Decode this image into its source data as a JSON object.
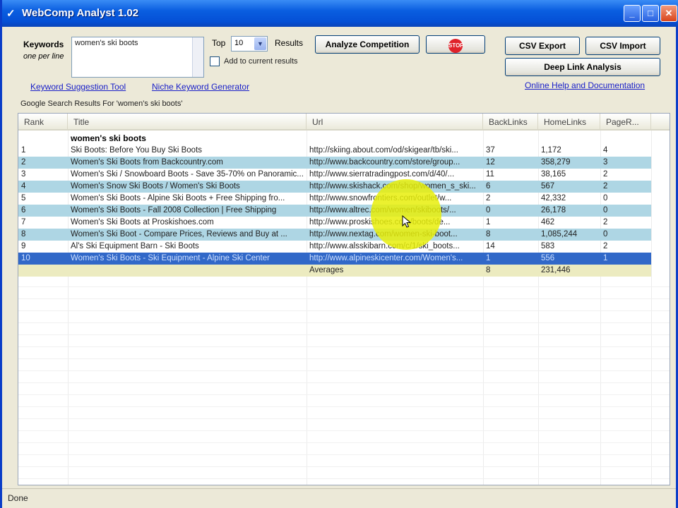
{
  "window": {
    "title": "WebComp Analyst 1.02",
    "minimize": "_",
    "maximize": "□",
    "close": "✕"
  },
  "toolbar": {
    "keywords_label": "Keywords",
    "keywords_sub": "one per line",
    "keywords_value": "women's ski boots",
    "top_label": "Top",
    "top_value": "10",
    "results_label": "Results",
    "add_to_current_label": "Add to current results",
    "add_to_current_checked": false,
    "analyze_button": "Analyze Competition",
    "stop_button": "STOP",
    "csv_export": "CSV Export",
    "csv_import": "CSV Import",
    "deep_link": "Deep Link Analysis",
    "keyword_suggestion_link": "Keyword Suggestion Tool",
    "niche_keyword_link": "Niche Keyword Generator",
    "help_link": "Online Help and Documentation"
  },
  "results_caption": "Google Search Results For 'women's ski boots'",
  "grid": {
    "columns": [
      "Rank",
      "Title",
      "Url",
      "BackLinks",
      "HomeLinks",
      "PageR..."
    ],
    "group_label": "women's ski boots",
    "rows": [
      {
        "rank": "1",
        "title": "Ski Boots: Before You Buy Ski Boots",
        "url": "http://skiing.about.com/od/skigear/tb/ski...",
        "backlinks": "37",
        "homelinks": "1,172",
        "pagerank": "4"
      },
      {
        "rank": "2",
        "title": "Women's Ski Boots from Backcountry.com",
        "url": "http://www.backcountry.com/store/group...",
        "backlinks": "12",
        "homelinks": "358,279",
        "pagerank": "3"
      },
      {
        "rank": "3",
        "title": "Women's Ski / Snowboard Boots - Save 35-70% on Panoramic...",
        "url": "http://www.sierratradingpost.com/d/40/...",
        "backlinks": "11",
        "homelinks": "38,165",
        "pagerank": "2"
      },
      {
        "rank": "4",
        "title": "Women's Snow Ski Boots / Women's Ski Boots",
        "url": "http://www.skishack.com/shop/women_s_ski...",
        "backlinks": "6",
        "homelinks": "567",
        "pagerank": "2"
      },
      {
        "rank": "5",
        "title": "Women's Ski Boots - Alpine Ski Boots + Free Shipping fro...",
        "url": "http://www.snowfrontiers.com/outlet/w...",
        "backlinks": "2",
        "homelinks": "42,332",
        "pagerank": "0"
      },
      {
        "rank": "6",
        "title": "Women's Ski Boots - Fall 2008 Collection | Free Shipping",
        "url": "http://www.altrec.com/women/skiboots/...",
        "backlinks": "0",
        "homelinks": "26,178",
        "pagerank": "0"
      },
      {
        "rank": "7",
        "title": "Women's Ski Boots at Proskishoes.com",
        "url": "http://www.proskishoes.com/boots/de...",
        "backlinks": "1",
        "homelinks": "462",
        "pagerank": "2"
      },
      {
        "rank": "8",
        "title": "Women's Ski Boot - Compare Prices, Reviews and Buy at ...",
        "url": "http://www.nextag.com/women-ski-boot...",
        "backlinks": "8",
        "homelinks": "1,085,244",
        "pagerank": "0"
      },
      {
        "rank": "9",
        "title": "Al's Ski Equipment Barn - Ski Boots",
        "url": "http://www.alsskibarn.com/c/1/ski_boots...",
        "backlinks": "14",
        "homelinks": "583",
        "pagerank": "2"
      },
      {
        "rank": "10",
        "title": "Women's Ski Boots - Ski Equipment - Alpine Ski Center",
        "url": "http://www.alpineskicenter.com/Women's...",
        "backlinks": "1",
        "homelinks": "556",
        "pagerank": "1"
      }
    ],
    "averages_label": "Averages",
    "avg_backlinks": "8",
    "avg_homelinks": "231,446"
  },
  "status": "Done",
  "colors": {
    "alt_row": "#aed6e4",
    "selected_row": "#3168c8",
    "averages_row": "#ecebc0",
    "link": "#1a20c8",
    "cursor_highlight": "#e8ee0a"
  }
}
